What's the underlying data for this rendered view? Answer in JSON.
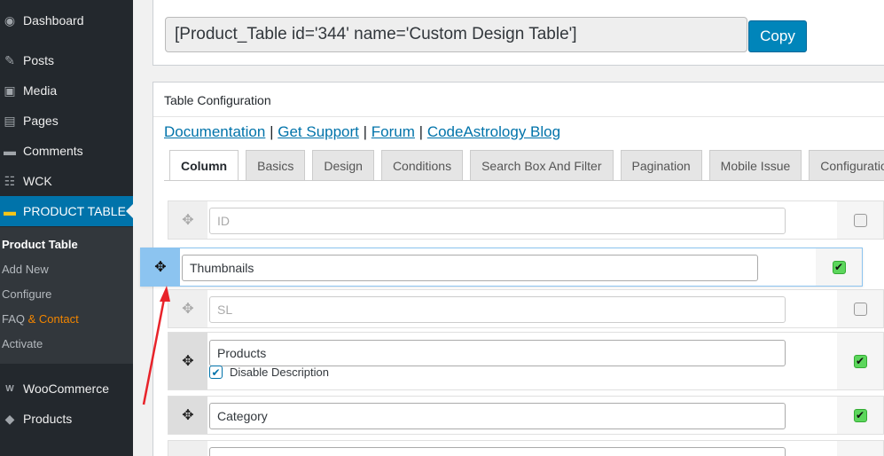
{
  "sidebar": {
    "items": [
      {
        "label": "Dashboard",
        "icon": "dashboard-icon",
        "glyph": "◉"
      },
      {
        "label": "Posts",
        "icon": "pin-icon",
        "glyph": "✎"
      },
      {
        "label": "Media",
        "icon": "media-icon",
        "glyph": "▣"
      },
      {
        "label": "Pages",
        "icon": "pages-icon",
        "glyph": "▤"
      },
      {
        "label": "Comments",
        "icon": "comment-icon",
        "glyph": "▬"
      },
      {
        "label": "WCK",
        "icon": "wck-icon",
        "glyph": "☷"
      },
      {
        "label": "PRODUCT TABLE",
        "icon": "product-table-icon",
        "glyph": "▬"
      },
      {
        "label": "WooCommerce",
        "icon": "woocommerce-icon",
        "glyph": "W"
      },
      {
        "label": "Products",
        "icon": "products-icon",
        "glyph": "◆"
      }
    ],
    "submenu": {
      "product_table": "Product Table",
      "add_new": "Add New",
      "configure": "Configure",
      "faq": "FAQ",
      "contact": "& Contact",
      "activate": "Activate"
    }
  },
  "shortcode": {
    "value": "[Product_Table id='344' name='Custom Design Table']",
    "copy_label": "Copy"
  },
  "config": {
    "title": "Table Configuration",
    "links": {
      "documentation": "Documentation",
      "support": "Get Support",
      "forum": "Forum",
      "blog": "CodeAstrology Blog",
      "sep": "|"
    },
    "tabs": [
      "Column",
      "Basics",
      "Design",
      "Conditions",
      "Search Box And Filter",
      "Pagination",
      "Mobile Issue",
      "Configuration"
    ]
  },
  "columns": {
    "id": {
      "placeholder": "ID",
      "checked": false
    },
    "thumbnails": {
      "value": "Thumbnails",
      "checked": true
    },
    "sl": {
      "placeholder": "SL",
      "checked": false
    },
    "products": {
      "value": "Products",
      "checked": true,
      "sub_label": "Disable Description"
    },
    "category": {
      "value": "Category",
      "checked": true
    }
  },
  "colors": {
    "accent": "#0073aa",
    "sidebar": "#23282d",
    "arrow": "#e8232a",
    "check_on": "#5cd65c"
  }
}
